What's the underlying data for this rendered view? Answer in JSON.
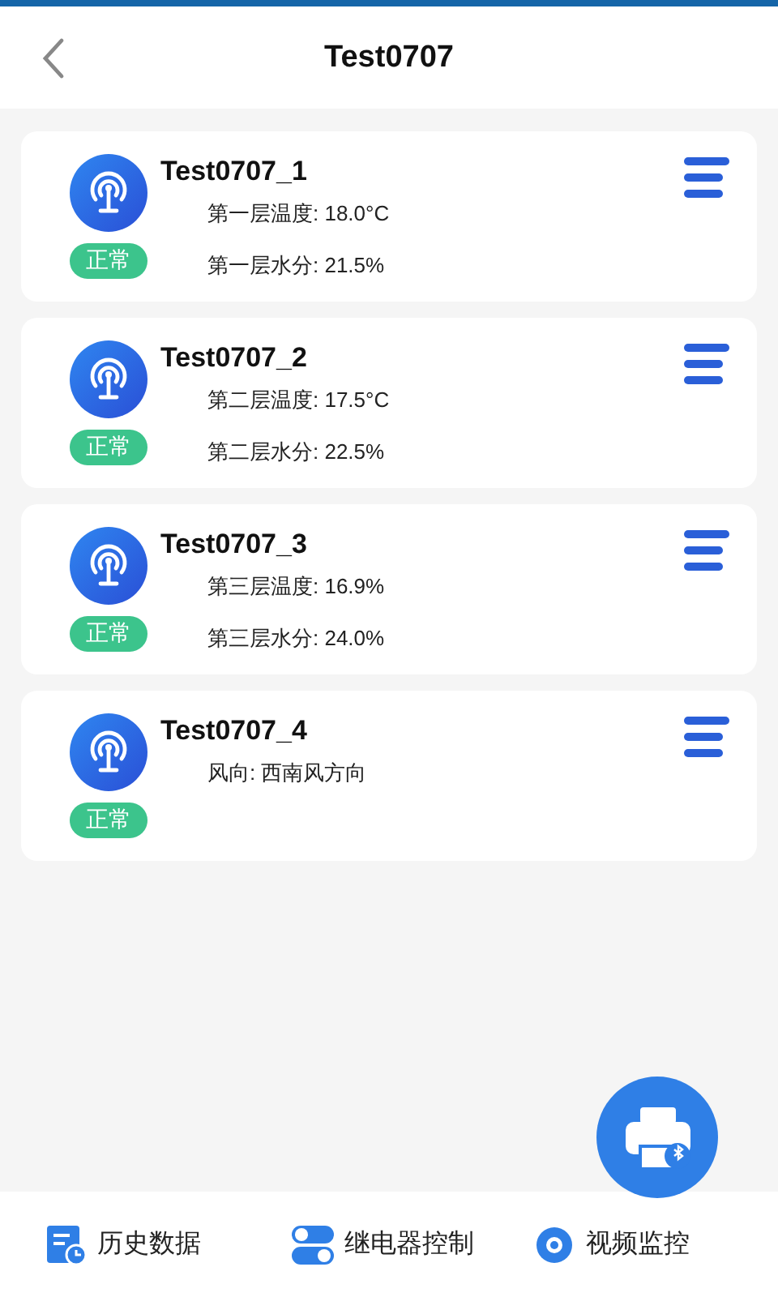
{
  "header": {
    "title": "Test0707"
  },
  "devices": [
    {
      "name": "Test0707_1",
      "status": "正常",
      "readings": [
        "第一层温度: 18.0°C",
        "第一层水分: 21.5%"
      ]
    },
    {
      "name": "Test0707_2",
      "status": "正常",
      "readings": [
        "第二层温度: 17.5°C",
        "第二层水分: 22.5%"
      ]
    },
    {
      "name": "Test0707_3",
      "status": "正常",
      "readings": [
        "第三层温度: 16.9%",
        "第三层水分: 24.0%"
      ]
    },
    {
      "name": "Test0707_4",
      "status": "正常",
      "readings": [
        "风向: 西南风方向"
      ]
    }
  ],
  "bottom_nav": [
    {
      "kind": "history",
      "label": "历史数据"
    },
    {
      "kind": "relay",
      "label": "继电器控制"
    },
    {
      "kind": "video",
      "label": "视频监控"
    }
  ]
}
